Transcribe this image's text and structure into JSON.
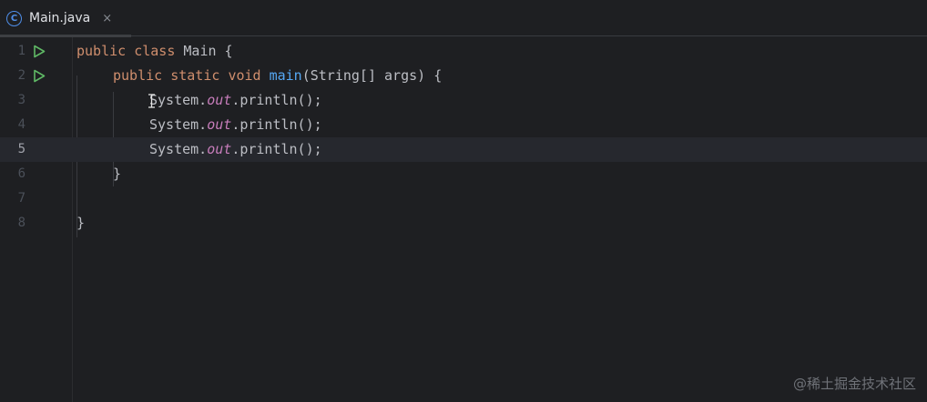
{
  "tab": {
    "icon": "java-class-icon",
    "icon_letter": "C",
    "label": "Main.java",
    "close": "×"
  },
  "editor": {
    "current_line": 5,
    "lines": [
      {
        "n": "1",
        "run": true
      },
      {
        "n": "2",
        "run": true
      },
      {
        "n": "3",
        "run": false
      },
      {
        "n": "4",
        "run": false
      },
      {
        "n": "5",
        "run": false
      },
      {
        "n": "6",
        "run": false
      },
      {
        "n": "7",
        "run": false
      },
      {
        "n": "8",
        "run": false
      }
    ],
    "code": {
      "l1_kw1": "public",
      "l1_kw2": "class",
      "l1_rest": " Main {",
      "l2_kw1": "public",
      "l2_kw2": "static",
      "l2_kw3": "void",
      "l2_fn": "main",
      "l2_rest": "(String[] args) {",
      "sys": "System.",
      "out": "out",
      "call": ".println();",
      "l6": "}",
      "l8": "}"
    }
  },
  "watermark": "@稀土掘金技术社区",
  "colors": {
    "background": "#1e1f22",
    "keyword": "#cf8e6d",
    "function": "#56a8f5",
    "static_field": "#c77dbb",
    "run_icon": "#5fb865",
    "tab_icon": "#4f8ee8"
  }
}
